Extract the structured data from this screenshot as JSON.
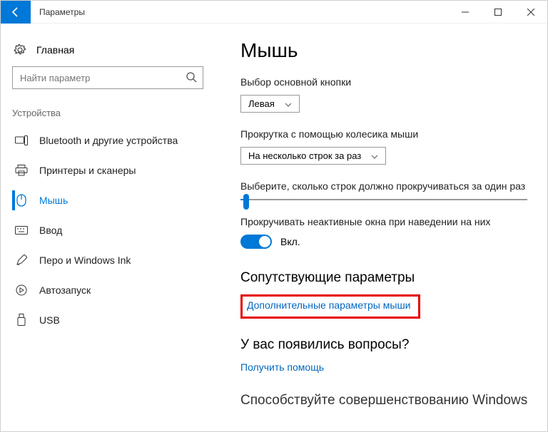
{
  "window": {
    "title": "Параметры"
  },
  "sidebar": {
    "home": "Главная",
    "search_placeholder": "Найти параметр",
    "group": "Устройства",
    "items": [
      {
        "label": "Bluetooth и другие устройства"
      },
      {
        "label": "Принтеры и сканеры"
      },
      {
        "label": "Мышь"
      },
      {
        "label": "Ввод"
      },
      {
        "label": "Перо и Windows Ink"
      },
      {
        "label": "Автозапуск"
      },
      {
        "label": "USB"
      }
    ]
  },
  "main": {
    "heading": "Мышь",
    "primary_button_label": "Выбор основной кнопки",
    "primary_button_value": "Левая",
    "scroll_label": "Прокрутка с помощью колесика мыши",
    "scroll_value": "На несколько строк за раз",
    "lines_label": "Выберите, сколько строк должно прокручиваться за один раз",
    "inactive_label": "Прокручивать неактивные окна при наведении на них",
    "toggle_state": "Вкл.",
    "related_heading": "Сопутствующие параметры",
    "related_link": "Дополнительные параметры мыши",
    "help_heading": "У вас появились вопросы?",
    "help_link": "Получить помощь",
    "footer_cut": "Способствуйте совершенствованию Windows"
  }
}
